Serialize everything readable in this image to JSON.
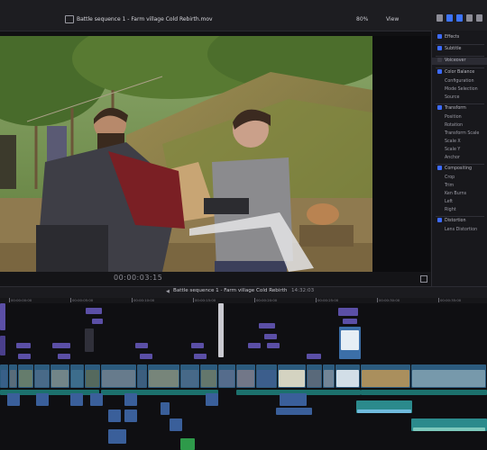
{
  "app": {
    "title": "Battle sequence 1 - Farm village Cold Rebirth.mov",
    "zoom": "80%",
    "view_menu": "View",
    "toolbar_icons": [
      "library-icon",
      "inspector-icon",
      "share-icon",
      "filter-icon",
      "settings-icon"
    ]
  },
  "viewer": {
    "timecode": "00:00:03:15"
  },
  "inspector": {
    "sections": [
      {
        "name": "Effects",
        "checked": true
      },
      {
        "name": "Subtitle",
        "checked": true
      },
      {
        "name": "Voiceover",
        "checked": false,
        "highlight": true
      },
      {
        "name": "Color Balance",
        "checked": true
      },
      {
        "name": "Configuration",
        "checked": false,
        "sub": true
      },
      {
        "name": "Mode Selection",
        "checked": false,
        "sub": true
      },
      {
        "name": "Source",
        "checked": false,
        "sub": true
      },
      {
        "name": "Transform",
        "checked": true
      },
      {
        "name": "Position",
        "checked": false,
        "sub": true
      },
      {
        "name": "Rotation",
        "checked": false,
        "sub": true
      },
      {
        "name": "Transform Scale",
        "checked": false,
        "sub": true
      },
      {
        "name": "Scale X",
        "checked": false,
        "sub": true
      },
      {
        "name": "Scale Y",
        "checked": false,
        "sub": true
      },
      {
        "name": "Anchor",
        "checked": false,
        "sub": true
      },
      {
        "name": "Compositing",
        "checked": true
      },
      {
        "name": "Crop",
        "checked": false,
        "sub": true
      },
      {
        "name": "Trim",
        "checked": false,
        "sub": true
      },
      {
        "name": "Ken Burns",
        "checked": false,
        "sub": true
      },
      {
        "name": "Left",
        "checked": false,
        "sub": true
      },
      {
        "name": "Right",
        "checked": false,
        "sub": true
      },
      {
        "name": "Distortion",
        "checked": true
      },
      {
        "name": "Lens Distortion",
        "checked": false,
        "sub": true
      }
    ]
  },
  "timeline": {
    "project_title": "Battle sequence 1 - Farm village Cold Rebirth",
    "duration": "14:32:03",
    "ruler_labels": [
      "00:00:00:00",
      "00:00:05:00",
      "00:00:10:00",
      "00:00:15:00",
      "00:00:20:00",
      "00:00:25:00",
      "00:00:30:00",
      "00:00:35:00"
    ]
  }
}
